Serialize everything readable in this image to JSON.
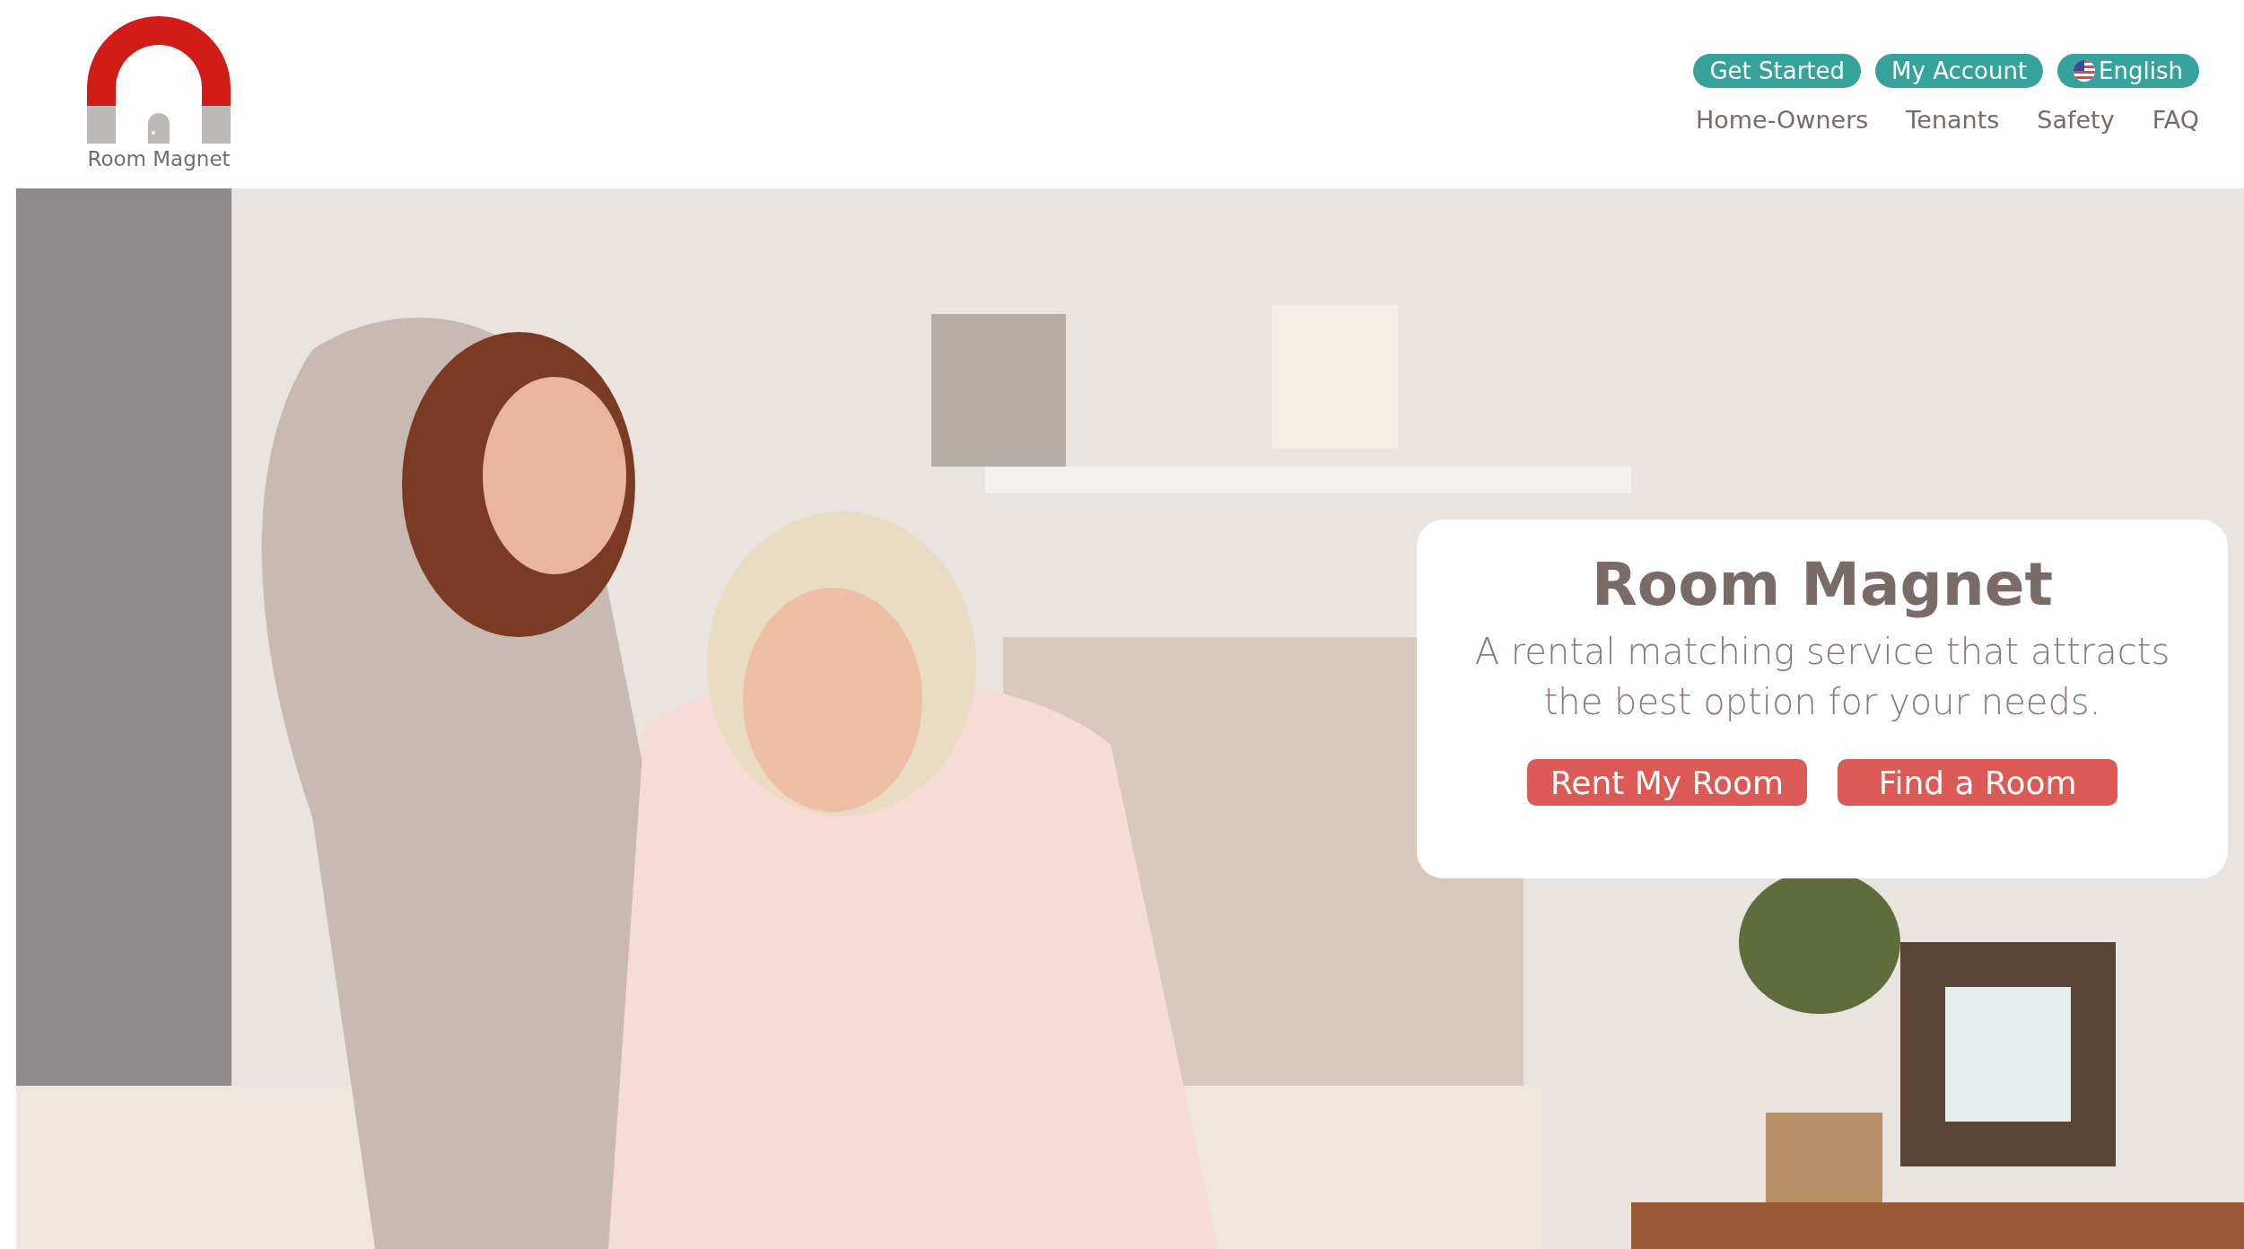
{
  "logo": {
    "text": "Room Magnet"
  },
  "top_buttons": [
    {
      "label": "Get Started",
      "kind": "plain"
    },
    {
      "label": "My Account",
      "kind": "plain"
    },
    {
      "label": "English",
      "kind": "language"
    }
  ],
  "nav": [
    "Home-Owners",
    "Tenants",
    "Safety",
    "FAQ"
  ],
  "hero": {
    "card": {
      "title": "Room Magnet",
      "subtitle": "A rental matching service that attracts the best option for your needs.",
      "buttons": [
        "Rent My Room",
        "Find a Room"
      ]
    }
  }
}
